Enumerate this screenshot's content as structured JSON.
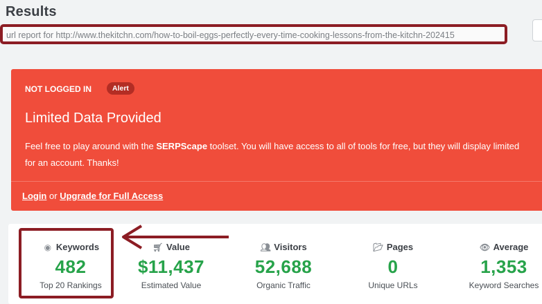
{
  "page": {
    "title": "Results"
  },
  "url_report": {
    "text": "url report for http://www.thekitchn.com/how-to-boil-eggs-perfectly-every-time-cooking-lessons-from-the-kitchn-202415"
  },
  "alert": {
    "heading": "NOT LOGGED IN",
    "badge": "Alert",
    "title": "Limited Data Provided",
    "desc_pre": "Feel free to play around with the ",
    "desc_brand": "SERPScape",
    "desc_post": " toolset. You will have access to all of tools for free, but they will display limited",
    "desc_line2": "for an account. Thanks!",
    "login": "Login",
    "or": "or",
    "upgrade": "Upgrade for Full Access"
  },
  "stats": [
    {
      "icon": "target-icon",
      "label": "Keywords",
      "value": "482",
      "sub": "Top 20 Rankings"
    },
    {
      "icon": "cart-icon",
      "label": "Value",
      "value": "$11,437",
      "sub": "Estimated Value"
    },
    {
      "icon": "users-icon",
      "label": "Visitors",
      "value": "52,688",
      "sub": "Organic Traffic"
    },
    {
      "icon": "folder-icon",
      "label": "Pages",
      "value": "0",
      "sub": "Unique URLs"
    },
    {
      "icon": "eye-icon",
      "label": "Average",
      "value": "1,353",
      "sub": "Keyword Searches"
    }
  ],
  "colors": {
    "alert_bg": "#f04d3b",
    "highlight": "#8c1d24",
    "stat_value": "#27a34a"
  }
}
